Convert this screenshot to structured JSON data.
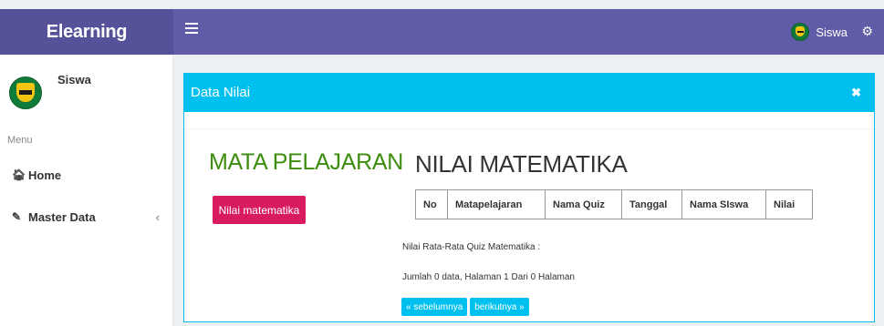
{
  "header": {
    "brand": "Elearning",
    "user_name": "Siswa"
  },
  "sidebar": {
    "user_name": "Siswa",
    "menu_header": "Menu",
    "items": [
      {
        "label": "Home",
        "icon": "home-icon"
      },
      {
        "label": "Master Data",
        "icon": "edit-icon"
      }
    ]
  },
  "box": {
    "title": "Data Nilai",
    "close_glyph": "✖"
  },
  "subjects": {
    "heading": "MATA PELAJARAN",
    "button_label": "Nilai matematika"
  },
  "grades": {
    "heading": "NILAI MATEMATIKA",
    "columns": [
      "No",
      "Matapelajaran",
      "Nama Quiz",
      "Tanggal",
      "Nama SIswa",
      "Nilai"
    ],
    "average_text": "Nilai Rata-Rata Quiz Matematika :",
    "summary_text": "Jumlah 0 data, Halaman 1 Dari 0 Halaman",
    "prev_label": "« sebelumnya",
    "next_label": "berikutnya »"
  },
  "colors": {
    "topbar": "#605ca8",
    "logo_bg": "#555299",
    "box_header": "#00c0ef",
    "subject_heading": "#3c8d0d",
    "subject_button": "#d81b60"
  }
}
